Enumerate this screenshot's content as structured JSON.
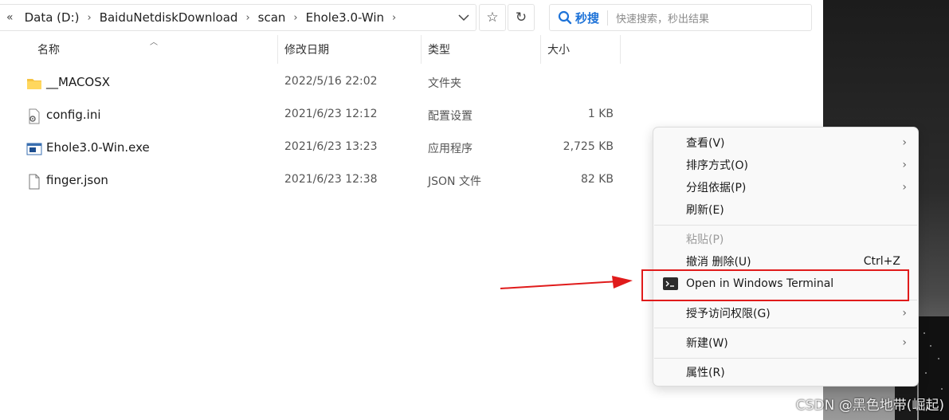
{
  "address_bar": {
    "more_icon": "double-chevron-left",
    "segments": [
      "Data (D:)",
      "BaiduNetdiskDownload",
      "scan",
      "Ehole3.0-Win"
    ],
    "dropdown_icon": "chevron-down",
    "favorite_icon": "star",
    "refresh_icon": "refresh"
  },
  "search": {
    "label": "秒搜",
    "placeholder": "快速搜索，秒出结果",
    "icon": "search-icon",
    "accent": "#1e73d8"
  },
  "columns": {
    "name": "名称",
    "modified": "修改日期",
    "type": "类型",
    "size": "大小"
  },
  "files": [
    {
      "name": "__MACOSX",
      "modified": "2022/5/16 22:02",
      "type": "文件夹",
      "size": "",
      "icon": "folder-icon"
    },
    {
      "name": "config.ini",
      "modified": "2021/6/23 12:12",
      "type": "配置设置",
      "size": "1 KB",
      "icon": "config-file-icon"
    },
    {
      "name": "Ehole3.0-Win.exe",
      "modified": "2021/6/23 13:23",
      "type": "应用程序",
      "size": "2,725 KB",
      "icon": "exe-file-icon"
    },
    {
      "name": "finger.json",
      "modified": "2021/6/23 12:38",
      "type": "JSON 文件",
      "size": "82 KB",
      "icon": "document-icon"
    }
  ],
  "context_menu": {
    "items": [
      {
        "label": "查看(V)",
        "submenu": true
      },
      {
        "label": "排序方式(O)",
        "submenu": true
      },
      {
        "label": "分组依据(P)",
        "submenu": true
      },
      {
        "label": "刷新(E)",
        "submenu": false
      },
      {
        "label": "粘贴(P)",
        "disabled": true
      },
      {
        "label": "撤消 删除(U)",
        "shortcut": "Ctrl+Z"
      },
      {
        "label": "Open in Windows Terminal",
        "icon": "terminal-icon"
      },
      {
        "label": "授予访问权限(G)",
        "submenu": true
      },
      {
        "label": "新建(W)",
        "submenu": true
      },
      {
        "label": "属性(R)",
        "submenu": false
      }
    ]
  },
  "annotation": {
    "color": "#e01b1b"
  },
  "watermark": "CSDN @黑色地带(崛起)"
}
